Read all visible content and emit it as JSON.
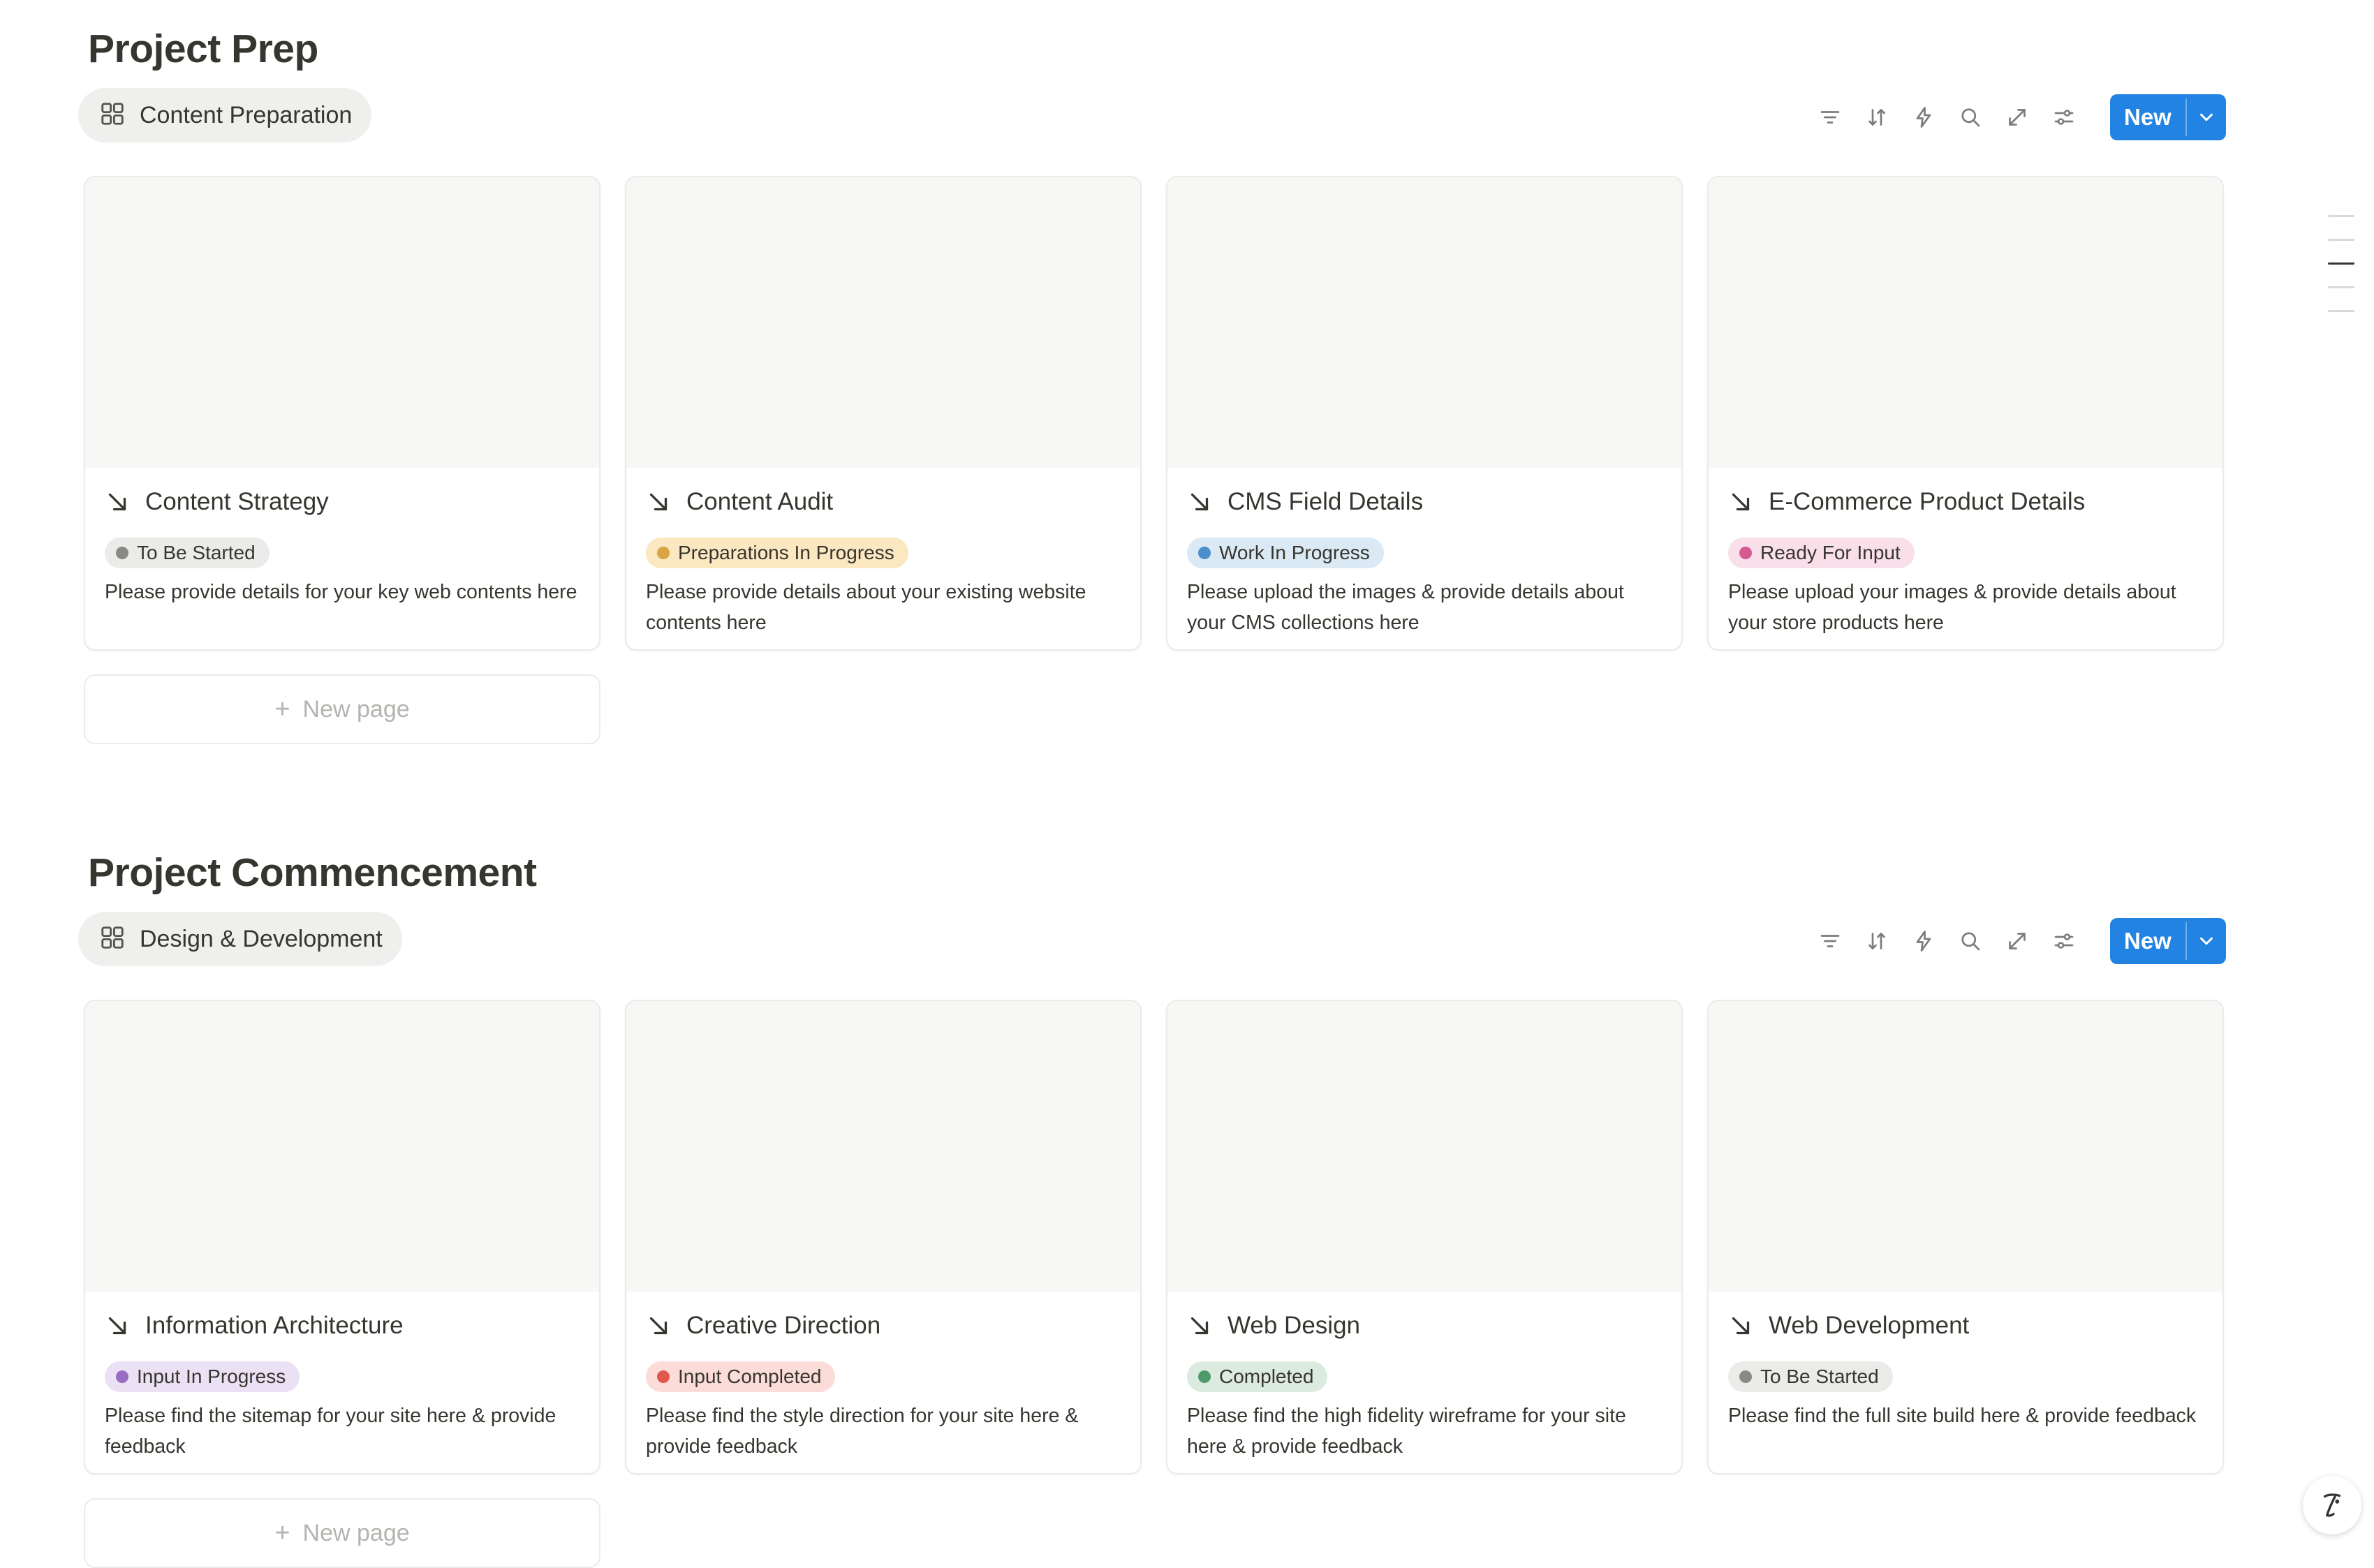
{
  "colors": {
    "accent": "#2383e2",
    "text": "#37352f",
    "muted": "#b4b3af"
  },
  "toolbar_icons": [
    "filter-icon",
    "sort-icon",
    "lightning-icon",
    "search-icon",
    "expand-icon",
    "settings-sliders-icon"
  ],
  "sections": [
    {
      "title": "Project Prep",
      "view_tab": {
        "label": "Content Preparation",
        "icon": "gallery-grid-icon"
      },
      "new_button": {
        "label": "New"
      },
      "new_page_label": "New page",
      "cards": [
        {
          "title": "Content Strategy",
          "status": "To Be Started",
          "status_bg": "#ebebea",
          "status_dot": "#8a8984",
          "description": "Please provide details for your key web contents here"
        },
        {
          "title": "Content Audit",
          "status": "Preparations In Progress",
          "status_bg": "#fbe7c0",
          "status_dot": "#d9a441",
          "description": "Please provide details about your existing website contents here"
        },
        {
          "title": "CMS Field Details",
          "status": "Work In Progress",
          "status_bg": "#dbe9f5",
          "status_dot": "#4a8ecb",
          "description": "Please upload the images & provide details about your CMS collections here"
        },
        {
          "title": "E-Commerce Product Details",
          "status": "Ready For Input",
          "status_bg": "#f9dfea",
          "status_dot": "#d45a91",
          "description": "Please upload your images & provide details about your store products here"
        }
      ]
    },
    {
      "title": "Project Commencement",
      "view_tab": {
        "label": "Design & Development",
        "icon": "gallery-grid-icon"
      },
      "new_button": {
        "label": "New"
      },
      "new_page_label": "New page",
      "cards": [
        {
          "title": "Information Architecture",
          "status": "Input In Progress",
          "status_bg": "#ebe1f4",
          "status_dot": "#9a6dc4",
          "description": "Please find the sitemap for your site here & provide feedback"
        },
        {
          "title": "Creative Direction",
          "status": "Input Completed",
          "status_bg": "#fcdcd9",
          "status_dot": "#e0574d",
          "description": "Please find the style direction for your site here & provide feedback"
        },
        {
          "title": "Web Design",
          "status": "Completed",
          "status_bg": "#dcebdf",
          "status_dot": "#4f9a6a",
          "description": "Please find the high fidelity wireframe for your site here & provide feedback"
        },
        {
          "title": "Web Development",
          "status": "To Be Started",
          "status_bg": "#ebebea",
          "status_dot": "#8a8984",
          "description": "Please find the full site build here & provide feedback"
        }
      ]
    }
  ]
}
